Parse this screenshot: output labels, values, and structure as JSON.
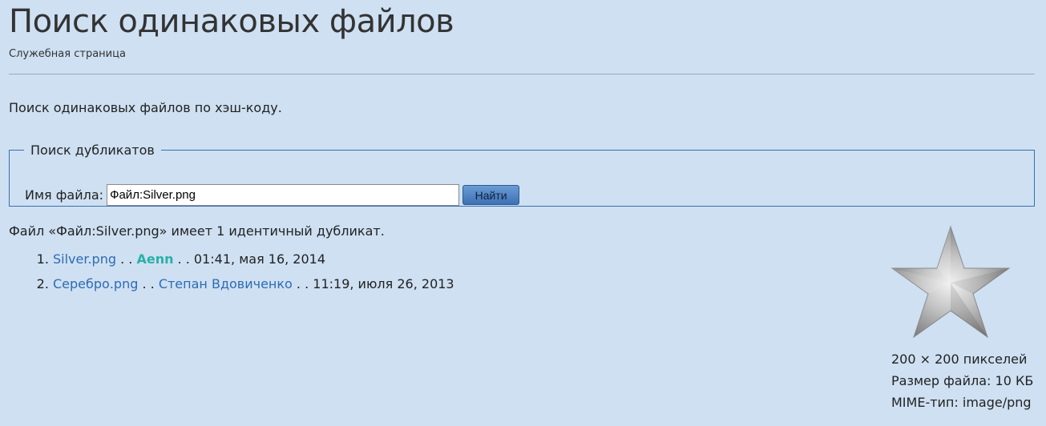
{
  "header": {
    "title": "Поиск одинаковых файлов",
    "subtitle": "Служебная страница"
  },
  "intro": "Поиск одинаковых файлов по хэш-коду.",
  "search_form": {
    "legend": "Поиск дубликатов",
    "label": "Имя файла:",
    "value": "Файл:Silver.png",
    "button": "Найти"
  },
  "result": {
    "summary": "Файл «Файл:Silver.png» имеет 1 идентичный дубликат.",
    "items": [
      {
        "file": "Silver.png",
        "sep1": " . . ",
        "user": "Aenn",
        "sep2": " . . ",
        "date": "01:41, мая 16, 2014"
      },
      {
        "file": "Серебро.png",
        "sep1": " . . ",
        "user": "Степан Вдовиченко",
        "sep2": " . . ",
        "date": "11:19, июля 26, 2013"
      }
    ]
  },
  "file_info": {
    "icon": "silver-star-icon",
    "dimensions": "200 × 200 пикселей",
    "size": "Размер файла: 10 КБ",
    "mime": "MIME-тип: image/png"
  },
  "colors": {
    "background": "#cee0f2",
    "link": "#2f6bb3",
    "user_link": "#2ab0a6",
    "fieldset_border": "#3b6fb0"
  }
}
